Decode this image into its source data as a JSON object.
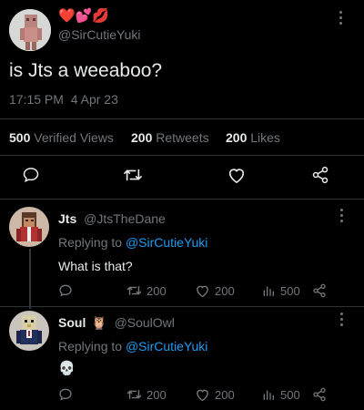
{
  "tweet": {
    "name_emojis": "❤️💕💋",
    "handle": "@SirCutieYuki",
    "text": "is Jts a weeaboo?",
    "time": "17:15 PM",
    "date": "4 Apr 23",
    "stats": {
      "views_count": "500",
      "views_label": "Verified Views",
      "retweets_count": "200",
      "retweets_label": "Retweets",
      "likes_count": "200",
      "likes_label": "Likes"
    }
  },
  "replies": [
    {
      "name": "Jts",
      "handle": "@JtsTheDane",
      "replying_prefix": "Replying to",
      "replying_to": "@SirCutieYuki",
      "text": "What is that?",
      "retweets": "200",
      "likes": "200",
      "views": "500"
    },
    {
      "name": "Soul",
      "name_emoji": "🦉",
      "handle": "@SoulOwl",
      "replying_prefix": "Replying to",
      "replying_to": "@SirCutieYuki",
      "text": "💀",
      "retweets": "200",
      "likes": "200",
      "views": "500"
    }
  ],
  "icons": [
    "comment-icon",
    "retweet-icon",
    "heart-icon",
    "share-icon",
    "views-icon",
    "more-icon"
  ],
  "colors": {
    "background": "#000000",
    "text": "#e7e9ea",
    "muted": "#71767b",
    "link": "#1d9bf0",
    "divider": "#2f3336"
  }
}
